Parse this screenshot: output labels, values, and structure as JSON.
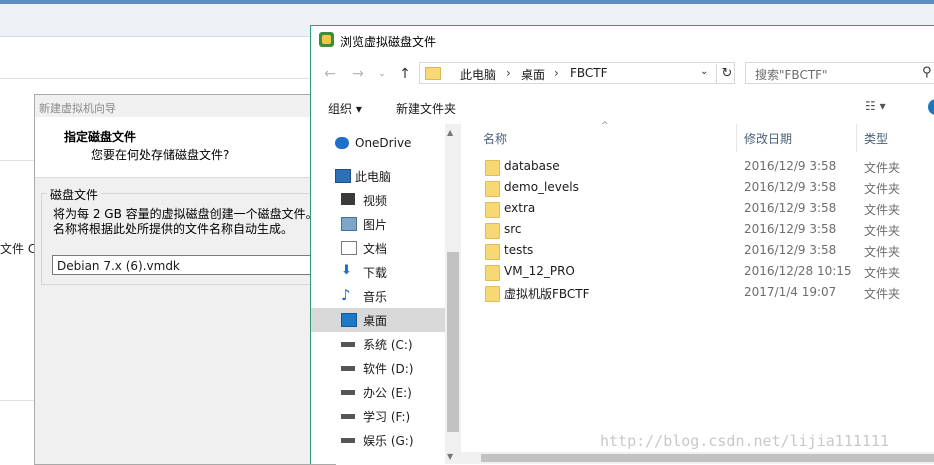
{
  "background": {
    "cut_label": "文件 C:."
  },
  "wizard": {
    "title": "新建虚拟机向导",
    "heading": "指定磁盘文件",
    "subheading": "您要在何处存储磁盘文件?",
    "group_label": "磁盘文件",
    "description_line1": "将为每 2 GB 容量的虚拟磁盘创建一个磁盘文件。",
    "description_line2": "名称将根据此处所提供的文件名称自动生成。",
    "file_value": "Debian 7.x (6).vmdk"
  },
  "browse": {
    "title": "浏览虚拟磁盘文件",
    "address": [
      "此电脑",
      "桌面",
      "FBCTF"
    ],
    "search_placeholder": "搜索\"FBCTF\"",
    "toolbar": {
      "organize": "组织 ▾",
      "new_folder": "新建文件夹"
    },
    "nav_items": [
      {
        "label": "OneDrive",
        "icon": "cloud-icon"
      },
      {
        "label": "此电脑",
        "icon": "computer-icon"
      },
      {
        "label": "视频",
        "icon": "video-icon"
      },
      {
        "label": "图片",
        "icon": "picture-icon"
      },
      {
        "label": "文档",
        "icon": "document-icon"
      },
      {
        "label": "下载",
        "icon": "download-icon"
      },
      {
        "label": "音乐",
        "icon": "music-icon"
      },
      {
        "label": "桌面",
        "icon": "desktop-icon",
        "selected": true
      },
      {
        "label": "系统 (C:)",
        "icon": "drive-icon"
      },
      {
        "label": "软件 (D:)",
        "icon": "drive-icon"
      },
      {
        "label": "办公 (E:)",
        "icon": "drive-icon"
      },
      {
        "label": "学习 (F:)",
        "icon": "drive-icon"
      },
      {
        "label": "娱乐 (G:)",
        "icon": "drive-icon"
      }
    ],
    "columns": {
      "name": "名称",
      "date": "修改日期",
      "type": "类型"
    },
    "files": [
      {
        "name": "database",
        "date": "2016/12/9 3:58",
        "type": "文件夹"
      },
      {
        "name": "demo_levels",
        "date": "2016/12/9 3:58",
        "type": "文件夹"
      },
      {
        "name": "extra",
        "date": "2016/12/9 3:58",
        "type": "文件夹"
      },
      {
        "name": "src",
        "date": "2016/12/9 3:58",
        "type": "文件夹"
      },
      {
        "name": "tests",
        "date": "2016/12/9 3:58",
        "type": "文件夹"
      },
      {
        "name": "VM_12_PRO",
        "date": "2016/12/28 10:15",
        "type": "文件夹"
      },
      {
        "name": "虚拟机版FBCTF",
        "date": "2017/1/4 19:07",
        "type": "文件夹"
      }
    ]
  },
  "watermark": "http://blog.csdn.net/lijia111111",
  "colors": {
    "accent": "#2d9a7a",
    "folder": "#f8d775",
    "selection": "#d9d9d9"
  }
}
